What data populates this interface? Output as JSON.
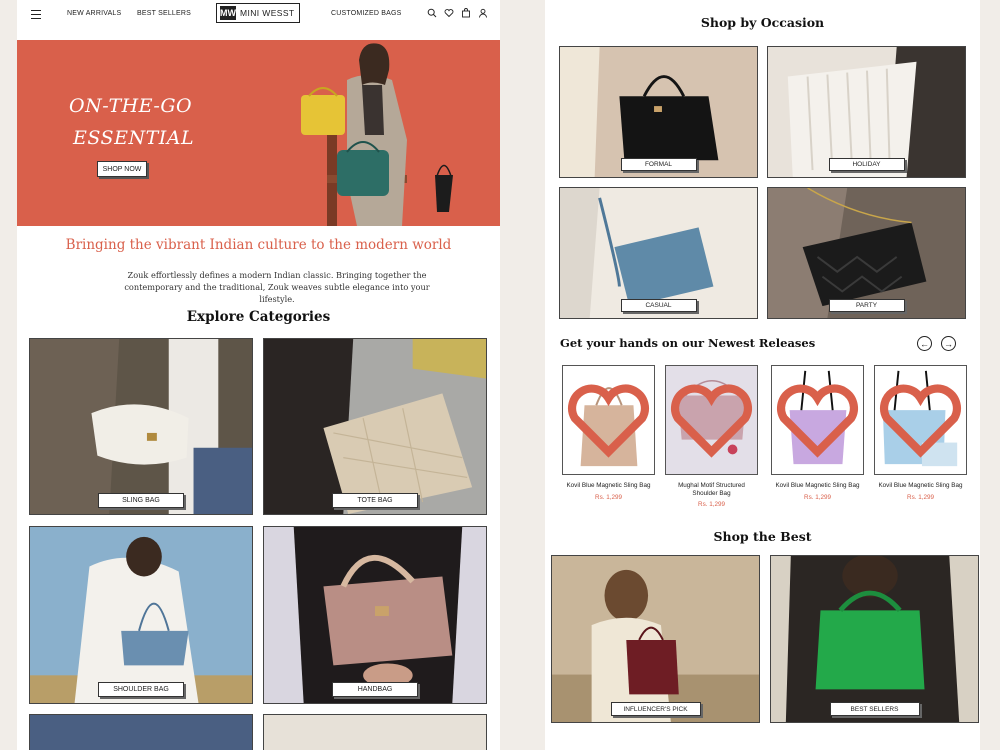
{
  "left_page": {
    "nav": {
      "links": [
        "NEW ARRIVALS",
        "BEST SELLERS",
        "CUSTOMIZED BAGS"
      ],
      "logo_mark": "MW",
      "logo_text": "MINI WESST",
      "icons": [
        "menu-icon",
        "search-icon",
        "heart-icon",
        "bag-icon",
        "user-icon"
      ]
    },
    "hero": {
      "line1": "ON-THE-GO",
      "line2": "ESSENTIAL",
      "cta": "SHOP NOW",
      "bg_color": "#d9604b"
    },
    "tagline": "Bringing the vibrant Indian culture to the modern world",
    "description": "Zouk effortlessly defines a modern Indian classic. Bringing together the contemporary and the traditional, Zouk weaves subtle elegance into your lifestyle.",
    "explore_title": "Explore Categories",
    "categories": [
      "SLING BAG",
      "TOTE BAG",
      "SHOULDER BAG",
      "HANDBAG"
    ]
  },
  "right_page": {
    "occasion_title": "Shop by Occasion",
    "occasions": [
      "FORMAL",
      "HOLIDAY",
      "CASUAL",
      "PARTY"
    ],
    "newest_title": "Get your hands on our Newest Releases",
    "products": [
      {
        "name": "Kovil Blue Magnetic Sling Bag",
        "price": "Rs. 1,299"
      },
      {
        "name": "Mughal Motif Structured Shoulder Bag",
        "price": "Rs. 1,299"
      },
      {
        "name": "Kovil Blue Magnetic Sling Bag",
        "price": "Rs. 1,299"
      },
      {
        "name": "Kovil Blue Magnetic Sling Bag",
        "price": "Rs. 1,299"
      }
    ],
    "best_title": "Shop the Best",
    "best": [
      "INFLUENCER'S PICK",
      "BEST SELLERS"
    ]
  },
  "colors": {
    "accent": "#d9604b",
    "page_bg": "#f1ede8"
  }
}
